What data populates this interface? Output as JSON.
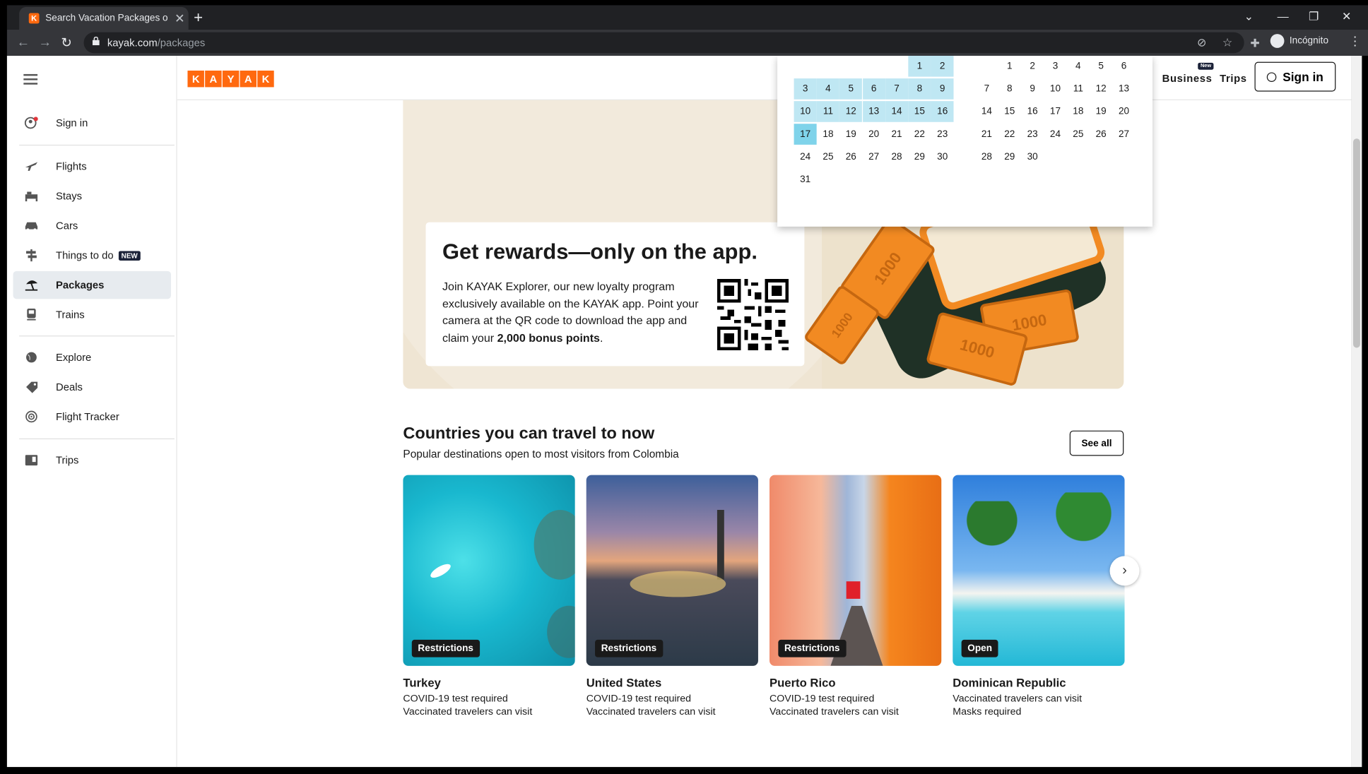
{
  "browser": {
    "tab_title": "Search Vacation Packages on KAYAK",
    "favicon_letter": "K",
    "url_host": "kayak.com",
    "url_path": "/packages",
    "profile_label": "Incógnito"
  },
  "sidebar": {
    "signin": "Sign in",
    "items": [
      {
        "label": "Flights",
        "icon": "plane-icon"
      },
      {
        "label": "Stays",
        "icon": "bed-icon"
      },
      {
        "label": "Cars",
        "icon": "car-icon"
      },
      {
        "label": "Things to do",
        "icon": "signpost-icon",
        "badge": "NEW"
      },
      {
        "label": "Packages",
        "icon": "beach-umbrella-icon",
        "active": true
      },
      {
        "label": "Trains",
        "icon": "train-icon"
      },
      {
        "label": "Explore",
        "icon": "globe-icon"
      },
      {
        "label": "Deals",
        "icon": "tag-icon"
      },
      {
        "label": "Flight Tracker",
        "icon": "radar-icon"
      },
      {
        "label": "Trips",
        "icon": "suitcase-icon"
      }
    ]
  },
  "header": {
    "logo_letters": [
      "K",
      "A",
      "Y",
      "A",
      "K"
    ],
    "business": "Business",
    "business_tag": "New",
    "trips": "Trips",
    "signin": "Sign in"
  },
  "calendar": {
    "month1_days": [
      "1",
      "2",
      "3",
      "4",
      "5",
      "6",
      "7",
      "8",
      "9",
      "10",
      "11",
      "12",
      "13",
      "14",
      "15",
      "16",
      "17",
      "18",
      "19",
      "20",
      "21",
      "22",
      "23",
      "24",
      "25",
      "26",
      "27",
      "28",
      "29",
      "30",
      "31"
    ],
    "month2_days": [
      "1",
      "2",
      "3",
      "4",
      "5",
      "6",
      "7",
      "8",
      "9",
      "10",
      "11",
      "12",
      "13",
      "14",
      "15",
      "16",
      "17",
      "18",
      "19",
      "20",
      "21",
      "22",
      "23",
      "24",
      "25",
      "26",
      "27",
      "28",
      "29",
      "30"
    ],
    "selected_day": "17"
  },
  "promo": {
    "title": "Get rewards—only on the app.",
    "text_prefix": "Join KAYAK Explorer, our new loyalty program exclusively available on the KAYAK app. Point your camera at the QR code to download the app and claim your ",
    "text_bold": "2,000 bonus points",
    "text_suffix": ".",
    "ticket_label": "1000"
  },
  "countries": {
    "title": "Countries you can travel to now",
    "subtitle": "Popular destinations open to most visitors from Colombia",
    "see_all": "See all",
    "cards": [
      {
        "name": "Turkey",
        "badge": "Restrictions",
        "line1": "COVID-19 test required",
        "line2": "Vaccinated travelers can visit"
      },
      {
        "name": "United States",
        "badge": "Restrictions",
        "line1": "COVID-19 test required",
        "line2": "Vaccinated travelers can visit"
      },
      {
        "name": "Puerto Rico",
        "badge": "Restrictions",
        "line1": "COVID-19 test required",
        "line2": "Vaccinated travelers can visit"
      },
      {
        "name": "Dominican Republic",
        "badge": "Open",
        "line1": "Vaccinated travelers can visit",
        "line2": "Masks required"
      }
    ]
  }
}
